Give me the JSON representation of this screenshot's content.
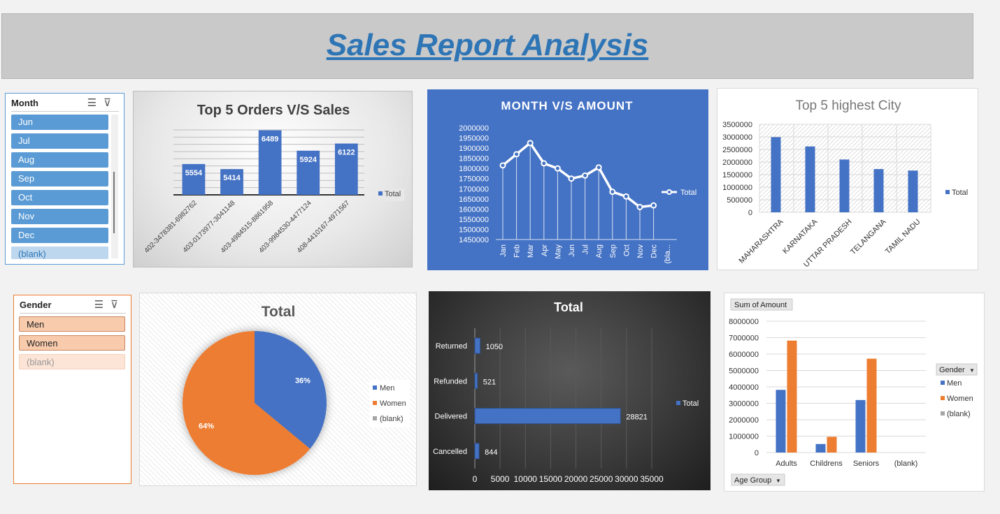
{
  "banner": {
    "title": "Sales Report Analysis"
  },
  "month_slicer": {
    "header": "Month",
    "items": [
      "Jun",
      "Jul",
      "Aug",
      "Sep",
      "Oct",
      "Nov",
      "Dec",
      "(blank)"
    ]
  },
  "gender_slicer": {
    "header": "Gender",
    "items": [
      "Men",
      "Women",
      "(blank)"
    ]
  },
  "colors": {
    "blue": "#4472c4",
    "orange": "#ed7d31",
    "gray": "#a5a5a5",
    "slicer_blue": "#5b9bd5",
    "slicer_orange": "#f8cbad"
  },
  "chart_data": [
    {
      "id": "top5-orders",
      "type": "bar",
      "title": "Top 5 Orders V/S Sales",
      "categories": [
        "402-3478381-6982762",
        "403-0173977-3041148",
        "403-4984515-8861958",
        "403-9984530-4477124",
        "408-4410167-4971567"
      ],
      "series": [
        {
          "name": "Total",
          "values": [
            5554,
            5414,
            6489,
            5924,
            6122
          ]
        }
      ],
      "ylim": [
        4700,
        6500
      ],
      "grid": true,
      "legend": "right"
    },
    {
      "id": "month-amount",
      "type": "line",
      "title": "MONTH V/S AMOUNT",
      "categories": [
        "Jan",
        "Feb",
        "Mar",
        "Apr",
        "May",
        "Jun",
        "Jul",
        "Aug",
        "Sep",
        "Oct",
        "Nov",
        "Dec",
        "(bla..."
      ],
      "series": [
        {
          "name": "Total",
          "values": [
            1815000,
            1870000,
            1925000,
            1825000,
            1800000,
            1750000,
            1765000,
            1805000,
            1685000,
            1662000,
            1610000,
            1618000,
            null
          ]
        }
      ],
      "yticks": [
        "2000000",
        "1950000",
        "1900000",
        "1850000",
        "1800000",
        "1750000",
        "1700000",
        "1650000",
        "1600000",
        "1550000",
        "1500000",
        "1450000"
      ],
      "ylim": [
        1450000,
        2000000
      ],
      "legend": "right"
    },
    {
      "id": "top5-city",
      "type": "bar",
      "title": "Top 5 highest City",
      "categories": [
        "MAHARASHTRA",
        "KARNATAKA",
        "UTTAR PRADESH",
        "TELANGANA",
        "TAMIL NADU"
      ],
      "series": [
        {
          "name": "Total",
          "values": [
            2990000,
            2620000,
            2100000,
            1720000,
            1660000
          ]
        }
      ],
      "yticks": [
        "3500000",
        "3000000",
        "2500000",
        "2000000",
        "1500000",
        "1000000",
        "500000",
        "0"
      ],
      "ylim": [
        0,
        3500000
      ],
      "grid": true,
      "legend": "right"
    },
    {
      "id": "gender-pie",
      "type": "pie",
      "title": "Total",
      "labels": [
        "Men",
        "Women",
        "(blank)"
      ],
      "values": [
        36,
        64,
        0
      ],
      "data_labels": [
        "36%",
        "64%",
        ""
      ],
      "legend": "right"
    },
    {
      "id": "status-bar",
      "type": "bar",
      "orientation": "horizontal",
      "title": "Total",
      "categories": [
        "Returned",
        "Refunded",
        "Delivered",
        "Cancelled"
      ],
      "series": [
        {
          "name": "Total",
          "values": [
            1050,
            521,
            28821,
            844
          ]
        }
      ],
      "xticks": [
        "0",
        "5000",
        "10000",
        "15000",
        "20000",
        "25000",
        "30000",
        "35000"
      ],
      "xlim": [
        0,
        35000
      ],
      "legend": "right"
    },
    {
      "id": "age-gender",
      "type": "bar",
      "title": "",
      "field_button": "Sum of Amount",
      "axis_button": "Age Group",
      "legend_title": "Gender",
      "categories": [
        "Adults",
        "Childrens",
        "Seniors",
        "(blank)"
      ],
      "series": [
        {
          "name": "Men",
          "values": [
            3820000,
            520000,
            3200000,
            0
          ]
        },
        {
          "name": "Women",
          "values": [
            6820000,
            960000,
            5720000,
            0
          ]
        },
        {
          "name": "(blank)",
          "values": [
            0,
            0,
            0,
            0
          ]
        }
      ],
      "yticks": [
        "8000000",
        "7000000",
        "6000000",
        "5000000",
        "4000000",
        "3000000",
        "2000000",
        "1000000",
        "0"
      ],
      "ylim": [
        0,
        8000000
      ],
      "grid": true,
      "legend": "right"
    }
  ]
}
